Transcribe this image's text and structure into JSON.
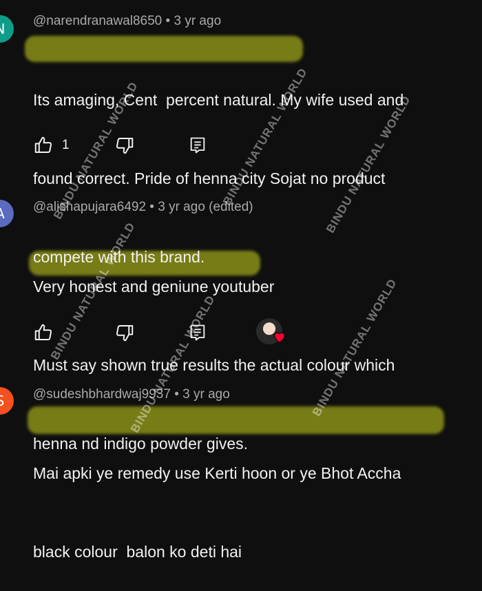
{
  "colors": {
    "background": "#0f0f0f",
    "highlight": "#cdd71e",
    "avatar_n": "#0f9d8a",
    "avatar_a": "#5c6bc0",
    "avatar_s": "#f4511e",
    "heart": "#ff0033"
  },
  "comments": [
    {
      "avatar_letter": "N",
      "author": "@narendranawal8650",
      "time": "3 yr ago",
      "lines": [
        "Its amaging, Cent  percent natural. My wife used and",
        "found correct. Pride of henna city Sojat no product",
        "compete with this brand."
      ],
      "like_count": "1"
    },
    {
      "avatar_letter": "A",
      "author": "@alishapujara6492",
      "time": "3 yr ago (edited)",
      "lines": [
        "Very honest and geniune youtuber",
        "Must say shown true results the actual colour which",
        "henna nd indigo powder gives."
      ],
      "like_count": ""
    },
    {
      "avatar_letter": "S",
      "author": "@sudeshbhardwaj9937",
      "time": "3 yr ago",
      "lines": [
        "Mai apki ye remedy use Kerti hoon or ye Bhot Accha",
        "black colour  balon ko deti hai"
      ],
      "like_count": ""
    }
  ],
  "icons": {
    "like": "thumbs-up-icon",
    "dislike": "thumbs-down-icon",
    "reply": "reply-icon",
    "creator_heart": "heart-icon"
  },
  "watermark": "BINDU NATURAL WORLD"
}
